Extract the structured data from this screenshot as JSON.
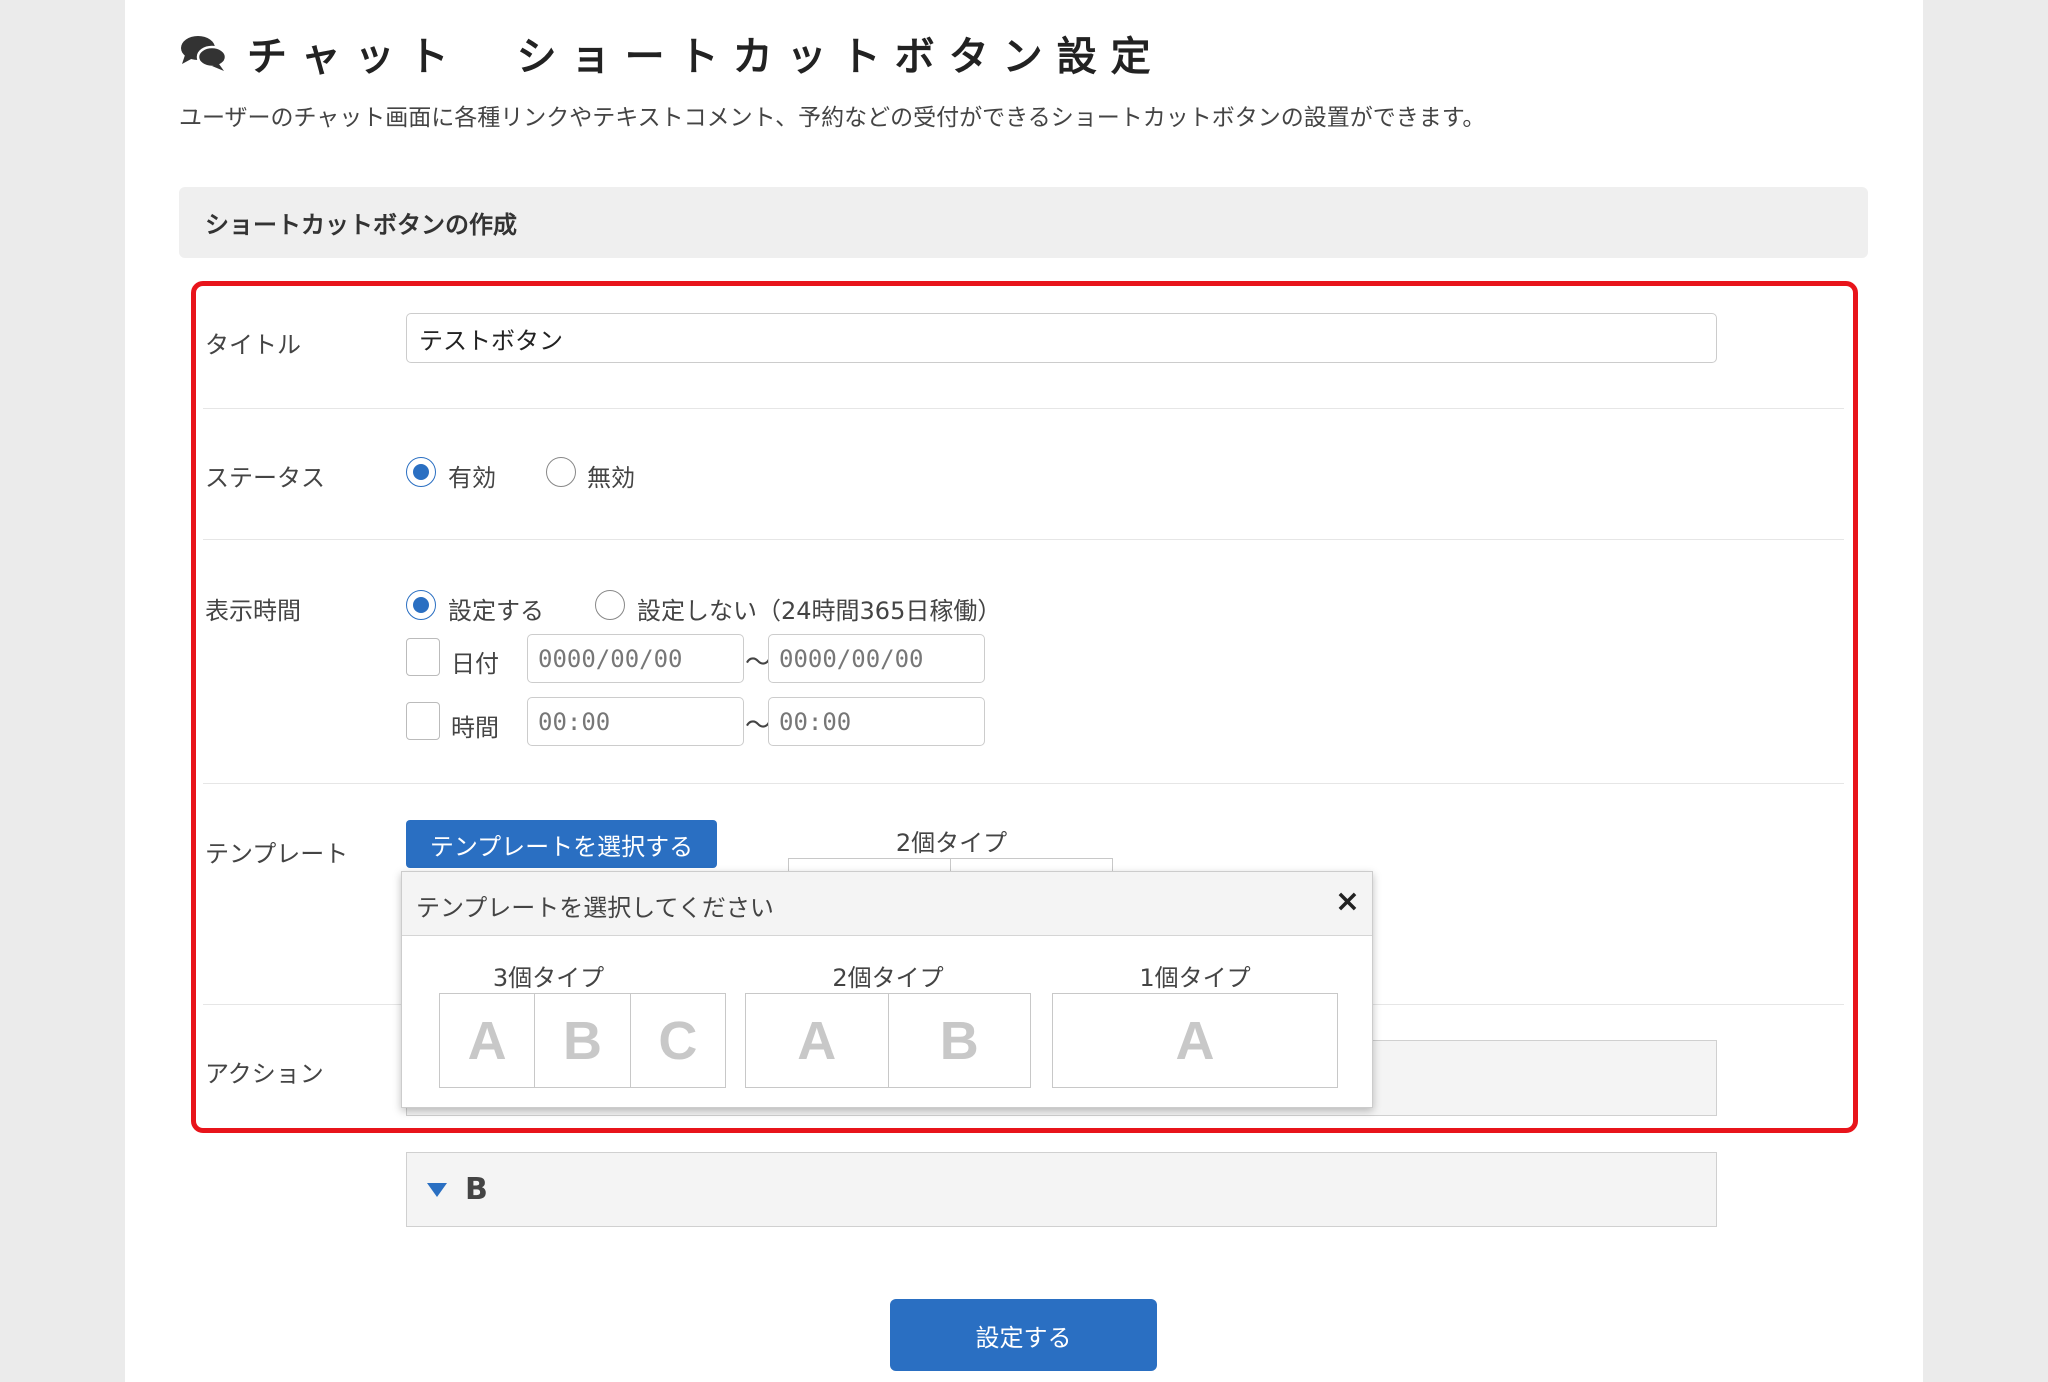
{
  "header": {
    "title": "チャット　ショートカットボタン設定",
    "description": "ユーザーのチャット画面に各種リンクやテキストコメント、予約などの受付ができるショートカットボタンの設置ができます。"
  },
  "section": {
    "title": "ショートカットボタンの作成"
  },
  "form": {
    "title_label": "タイトル",
    "title_value": "テストボタン",
    "status_label": "ステータス",
    "status_options": {
      "enabled": "有効",
      "disabled": "無効"
    },
    "status_selected": "有効",
    "display_time_label": "表示時間",
    "display_time_options": {
      "set": "設定する",
      "unset": "設定しない（24時間365日稼働）"
    },
    "display_time_selected": "設定する",
    "date_label": "日付",
    "date_from_placeholder": "0000/00/00",
    "date_to_placeholder": "0000/00/00",
    "time_label": "時間",
    "time_from_placeholder": "00:00",
    "time_to_placeholder": "00:00",
    "range_separator": "〜",
    "template_label": "テンプレート",
    "template_button": "テンプレートを選択する",
    "current_template_label": "2個タイプ",
    "action_label": "アクション",
    "accordion_b": "B"
  },
  "modal": {
    "title": "テンプレートを選択してください",
    "close": "×",
    "types": [
      {
        "label": "3個タイプ",
        "cells": [
          "A",
          "B",
          "C"
        ]
      },
      {
        "label": "2個タイプ",
        "cells": [
          "A",
          "B"
        ]
      },
      {
        "label": "1個タイプ",
        "cells": [
          "A"
        ]
      }
    ]
  },
  "submit_label": "設定する",
  "colors": {
    "primary": "#2a6fc2",
    "highlight_border": "#e8141b",
    "background": "#ebebeb"
  },
  "icons": {
    "header": "chat-bubbles-icon",
    "accordion": "triangle-down-icon"
  }
}
